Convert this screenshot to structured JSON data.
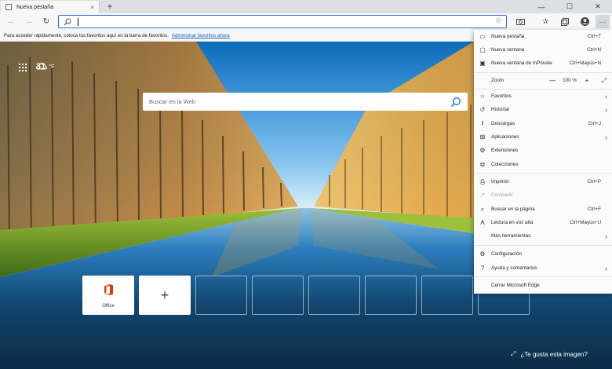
{
  "tab": {
    "title": "Nueva pestaña",
    "close": "×",
    "new_tab": "+"
  },
  "window_controls": {
    "minimize": "—",
    "maximize": "☐",
    "close": "✕"
  },
  "toolbar": {
    "back": "←",
    "forward": "→",
    "refresh": "↻",
    "address_value": "",
    "more": "···"
  },
  "favorites_bar": {
    "message": "Para acceder rápidamente, coloca tus favoritos aquí en la barra de favoritos.",
    "link": "Administrar favoritos ahora"
  },
  "newtab": {
    "weather_temp": "31",
    "weather_unit": "°F",
    "search_placeholder": "Buscar en la Web",
    "tiles": [
      {
        "label": "Office"
      },
      {
        "label": "+"
      }
    ],
    "like_image": "¿Te gusta esta imagen?"
  },
  "menu": {
    "items": [
      {
        "label": "Nueva pestaña",
        "shortcut": "Ctrl+T",
        "icon": "new-tab-icon"
      },
      {
        "label": "Nueva ventana",
        "shortcut": "Ctrl+N",
        "icon": "new-window-icon"
      },
      {
        "label": "Nueva ventana de InPrivate",
        "shortcut": "Ctrl+Mayús+N",
        "icon": "inprivate-icon"
      },
      {
        "label": "Zoom",
        "shortcut": "",
        "icon": ""
      },
      {
        "label": "Favoritos",
        "shortcut": "",
        "icon": "star-icon",
        "submenu": true
      },
      {
        "label": "Historial",
        "shortcut": "",
        "icon": "history-icon",
        "submenu": true
      },
      {
        "label": "Descargas",
        "shortcut": "Ctrl+J",
        "icon": "download-icon"
      },
      {
        "label": "Aplicaciones",
        "shortcut": "",
        "icon": "apps-icon",
        "submenu": true
      },
      {
        "label": "Extensiones",
        "shortcut": "",
        "icon": "extensions-icon"
      },
      {
        "label": "Colecciones",
        "shortcut": "",
        "icon": "collections-icon"
      },
      {
        "label": "Imprimir",
        "shortcut": "Ctrl+P",
        "icon": "print-icon"
      },
      {
        "label": "Compartir",
        "shortcut": "",
        "icon": "share-icon",
        "disabled": true
      },
      {
        "label": "Buscar en la página",
        "shortcut": "Ctrl+F",
        "icon": "find-icon"
      },
      {
        "label": "Lectura en voz alta",
        "shortcut": "Ctrl+Mayús+U",
        "icon": "read-aloud-icon"
      },
      {
        "label": "Más herramientas",
        "shortcut": "",
        "icon": "",
        "submenu": true
      },
      {
        "label": "Configuración",
        "shortcut": "",
        "icon": "gear-icon"
      },
      {
        "label": "Ayuda y comentarios",
        "shortcut": "",
        "icon": "help-icon",
        "submenu": true
      },
      {
        "label": "Cerrar Microsoft Edge",
        "shortcut": "",
        "icon": ""
      }
    ],
    "zoom": {
      "minus": "—",
      "value": "100 %",
      "plus": "+",
      "fullscreen": "⤢"
    }
  },
  "colors": {
    "accent": "#2d6fd6",
    "office_red": "#d83b01",
    "menu_bg": "#fbfbfb"
  }
}
